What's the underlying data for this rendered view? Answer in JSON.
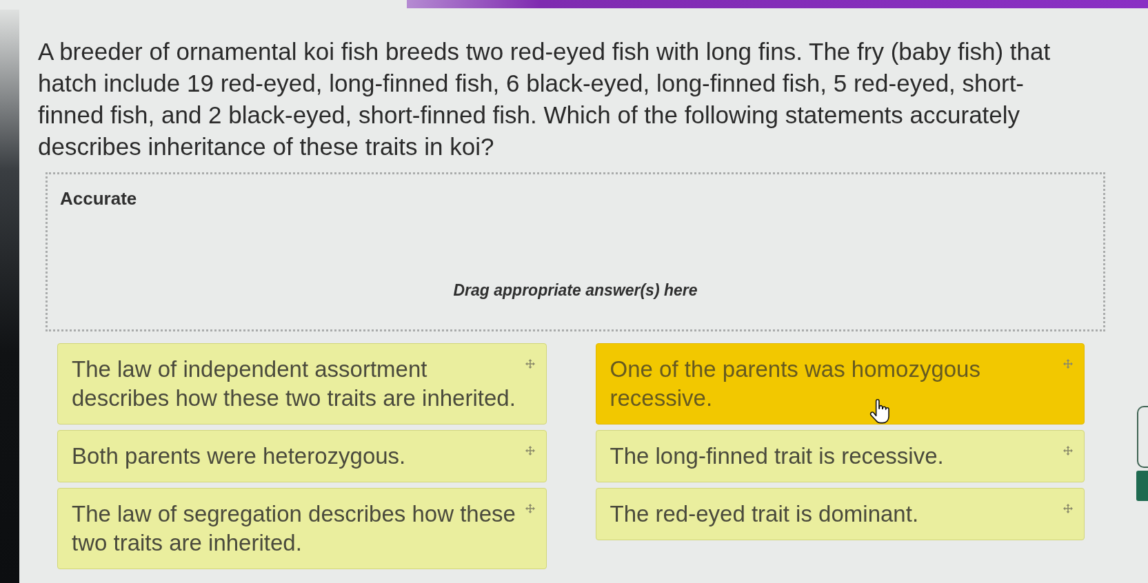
{
  "question": "A breeder of ornamental koi fish breeds two red-eyed fish with long fins. The fry (baby fish) that hatch include 19 red-eyed, long-finned fish, 6 black-eyed, long-finned fish, 5 red-eyed, short-finned fish, and 2 black-eyed, short-finned fish. Which of the following statements accurately describes inheritance of these traits in koi?",
  "drop_zone": {
    "title": "Accurate",
    "hint": "Drag appropriate answer(s) here"
  },
  "answer_columns": [
    {
      "answers": [
        {
          "text": "The law of independent assortment describes how these two traits are inherited.",
          "highlighted": false
        },
        {
          "text": "Both parents were heterozygous.",
          "highlighted": false
        },
        {
          "text": "The law of segregation describes how these two traits are inherited.",
          "highlighted": false
        }
      ]
    },
    {
      "answers": [
        {
          "text": "One of the parents was homozygous recessive.",
          "highlighted": true
        },
        {
          "text": "The long-finned trait is recessive.",
          "highlighted": false
        },
        {
          "text": "The red-eyed trait is dominant.",
          "highlighted": false
        }
      ]
    }
  ]
}
